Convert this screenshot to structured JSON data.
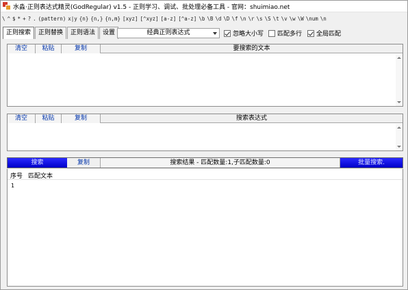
{
  "window": {
    "title": "水淼·正则表达式精灵(GodRegular) v1.5 - 正则学习、调试、批处理必备工具 - 官网：shuimiao.net"
  },
  "syntax_tokens": [
    "\\",
    "^",
    "$",
    "*",
    "+",
    "?",
    ".",
    "(pattern)",
    "x|y",
    "{n}",
    "{n,}",
    "{n,m}",
    "[xyz]",
    "[^xyz]",
    "[a-z]",
    "[^a-z]",
    "\\b",
    "\\B",
    "\\d",
    "\\D",
    "\\f",
    "\\n",
    "\\r",
    "\\s",
    "\\S",
    "\\t",
    "\\v",
    "\\w",
    "\\W",
    "\\num",
    "\\n"
  ],
  "tabs": [
    "正则搜索",
    "正则替换",
    "正则语法",
    "设置"
  ],
  "preset_select": {
    "value": "经典正则表达式"
  },
  "options": {
    "ignore_case": {
      "label": "忽略大小写",
      "checked": true
    },
    "multiline": {
      "label": "匹配多行",
      "checked": false
    },
    "global": {
      "label": "全局匹配",
      "checked": true
    }
  },
  "text_panel": {
    "clear": "清空",
    "paste": "粘贴",
    "copy": "复制",
    "title": "要搜索的文本"
  },
  "regex_panel": {
    "clear": "清空",
    "paste": "粘贴",
    "copy": "复制",
    "title": "搜索表达式"
  },
  "results_bar": {
    "search": "搜索",
    "copy": "复制",
    "title": "搜索结果 - 匹配数量:1,子匹配数量:0",
    "batch": "批量搜索."
  },
  "results_table": {
    "columns": [
      "序号",
      "匹配文本"
    ],
    "rows": [
      [
        "1",
        ""
      ]
    ]
  },
  "colors": {
    "accent_blue": "#0000c8",
    "link_blue": "#0033aa"
  }
}
